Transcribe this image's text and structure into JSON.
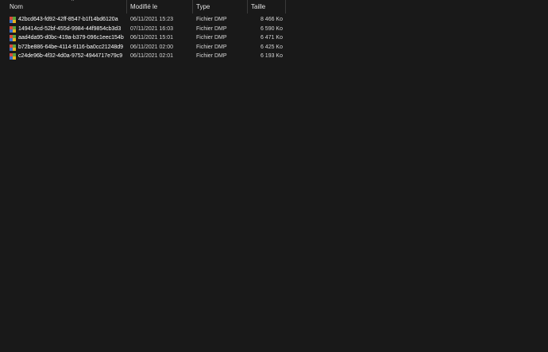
{
  "columns": {
    "name": "Nom",
    "modified": "Modifié le",
    "type": "Type",
    "size": "Taille"
  },
  "sort_indicator": "^",
  "files": [
    {
      "name": "42bcd643-fd92-42ff-8547-b1f14bd6120a",
      "modified": "06/11/2021 15:23",
      "type": "Fichier DMP",
      "size": "8 466 Ko",
      "icon": "dmp-file-icon"
    },
    {
      "name": "149414cd-52bf-455d-9984-44f9854cb3d3",
      "modified": "07/11/2021 16:03",
      "type": "Fichier DMP",
      "size": "6 590 Ko",
      "icon": "dmp-file-icon"
    },
    {
      "name": "aad4da95-d0bc-419a-b379-096c1eec154b",
      "modified": "06/11/2021 15:01",
      "type": "Fichier DMP",
      "size": "6 471 Ko",
      "icon": "dmp-file-icon"
    },
    {
      "name": "b72be886-64be-4114-9116-ba0cc21248d9",
      "modified": "06/11/2021 02:00",
      "type": "Fichier DMP",
      "size": "6 425 Ko",
      "icon": "dmp-file-icon"
    },
    {
      "name": "c24de96b-4f32-4d0a-9752-4944717e79c9",
      "modified": "06/11/2021 02:01",
      "type": "Fichier DMP",
      "size": "6 193 Ko",
      "icon": "dmp-file-icon"
    }
  ],
  "colors": {
    "background": "#191919",
    "text": "#ffffff",
    "separator": "#3a3a3a"
  }
}
